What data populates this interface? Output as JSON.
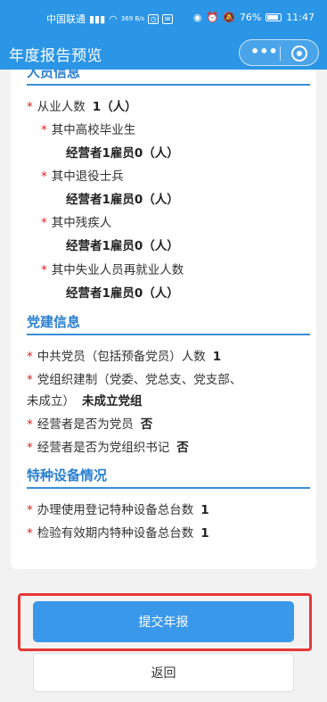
{
  "status_bar": {
    "carrier": "中国联通",
    "network_speed": "369 B/s",
    "battery": "76%",
    "time": "11:47"
  },
  "nav": {
    "title": "年度报告预览",
    "more_icon": "more-dots-icon",
    "close_icon": "target-close-icon"
  },
  "sections": {
    "personnel": {
      "title": "人员信息",
      "employees_label": "从业人数",
      "employees_value": "1（人）",
      "graduates_label": "其中高校毕业生",
      "graduates_value": "经营者1雇员0（人）",
      "veterans_label": "其中退役士兵",
      "veterans_value": "经营者1雇员0（人）",
      "disabled_label": "其中残疾人",
      "disabled_value": "经营者1雇员0（人）",
      "reemployed_label": "其中失业人员再就业人数",
      "reemployed_value": "经营者1雇员0（人）"
    },
    "party": {
      "title": "党建信息",
      "members_label": "中共党员（包括预备党员）人数",
      "members_value": "1",
      "org_label_line1": "党组织建制（党委、党总支、党支部、",
      "org_label_line2": "未成立）",
      "org_value": "未成立党组",
      "operator_member_label": "经营者是否为党员",
      "operator_member_value": "否",
      "operator_secretary_label": "经营者是否为党组织书记",
      "operator_secretary_value": "否"
    },
    "equipment": {
      "title": "特种设备情况",
      "registered_label": "办理使用登记特种设备总台数",
      "registered_value": "1",
      "inspected_label": "检验有效期内特种设备总台数",
      "inspected_value": "1"
    }
  },
  "buttons": {
    "submit": "提交年报",
    "back": "返回"
  },
  "colors": {
    "brand_blue": "#2b95e6",
    "section_title": "#2b7fd0",
    "required_star": "#e02020",
    "highlight_red": "#e53935"
  }
}
